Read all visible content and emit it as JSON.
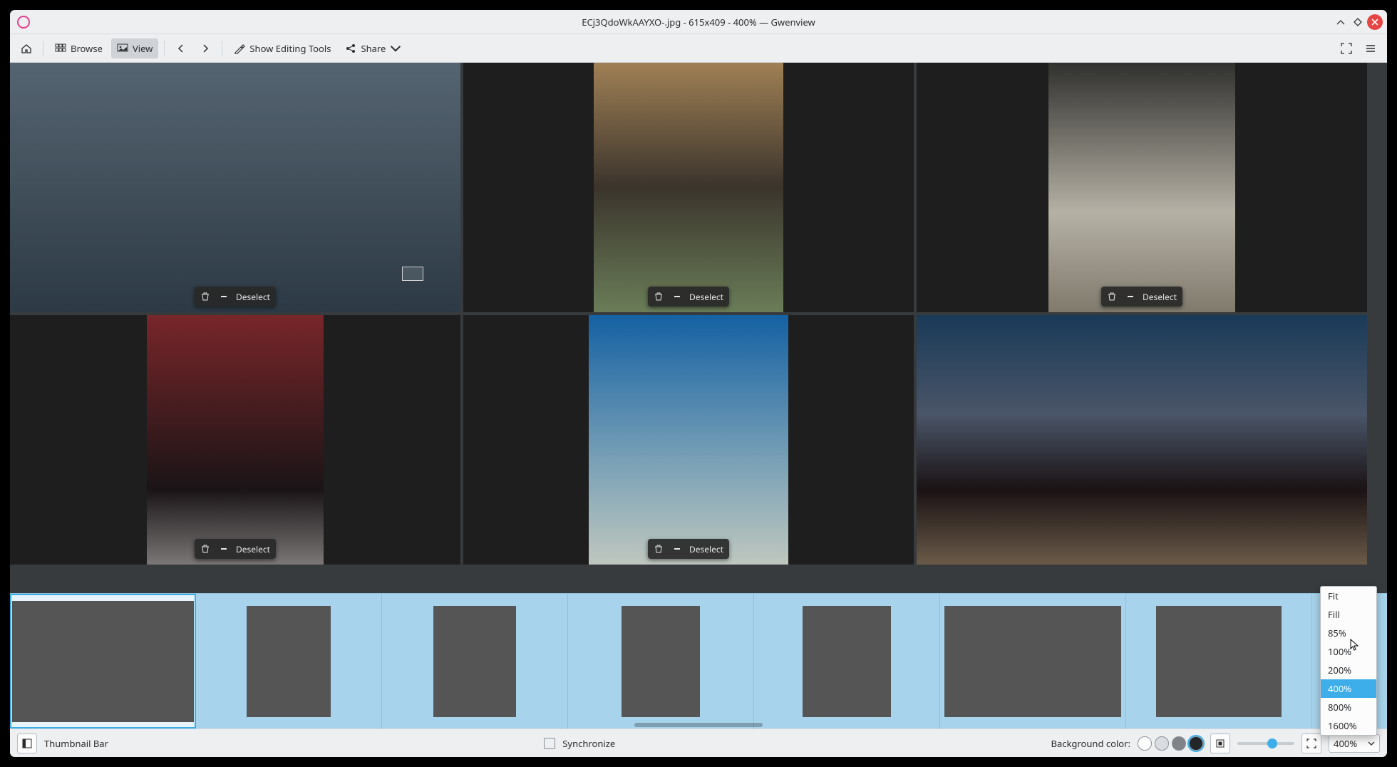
{
  "title": "ECj3QdoWkAAYXO-.jpg - 615x409 - 400% — Gwenview",
  "toolbar": {
    "browse": "Browse",
    "view": "View",
    "show_editing": "Show Editing Tools",
    "share": "Share"
  },
  "pane_action": {
    "deselect": "Deselect"
  },
  "zoom_options": [
    "Fit",
    "Fill",
    "85%",
    "100%",
    "200%",
    "400%",
    "800%",
    "1600%"
  ],
  "zoom_selected": "400%",
  "status": {
    "thumbnail_bar": "Thumbnail Bar",
    "synchronize": "Synchronize",
    "bg_label": "Background color:",
    "zoom_value": "400%"
  },
  "bg_colors": [
    "#ffffff",
    "#d9dde1",
    "#808488",
    "#232629"
  ]
}
